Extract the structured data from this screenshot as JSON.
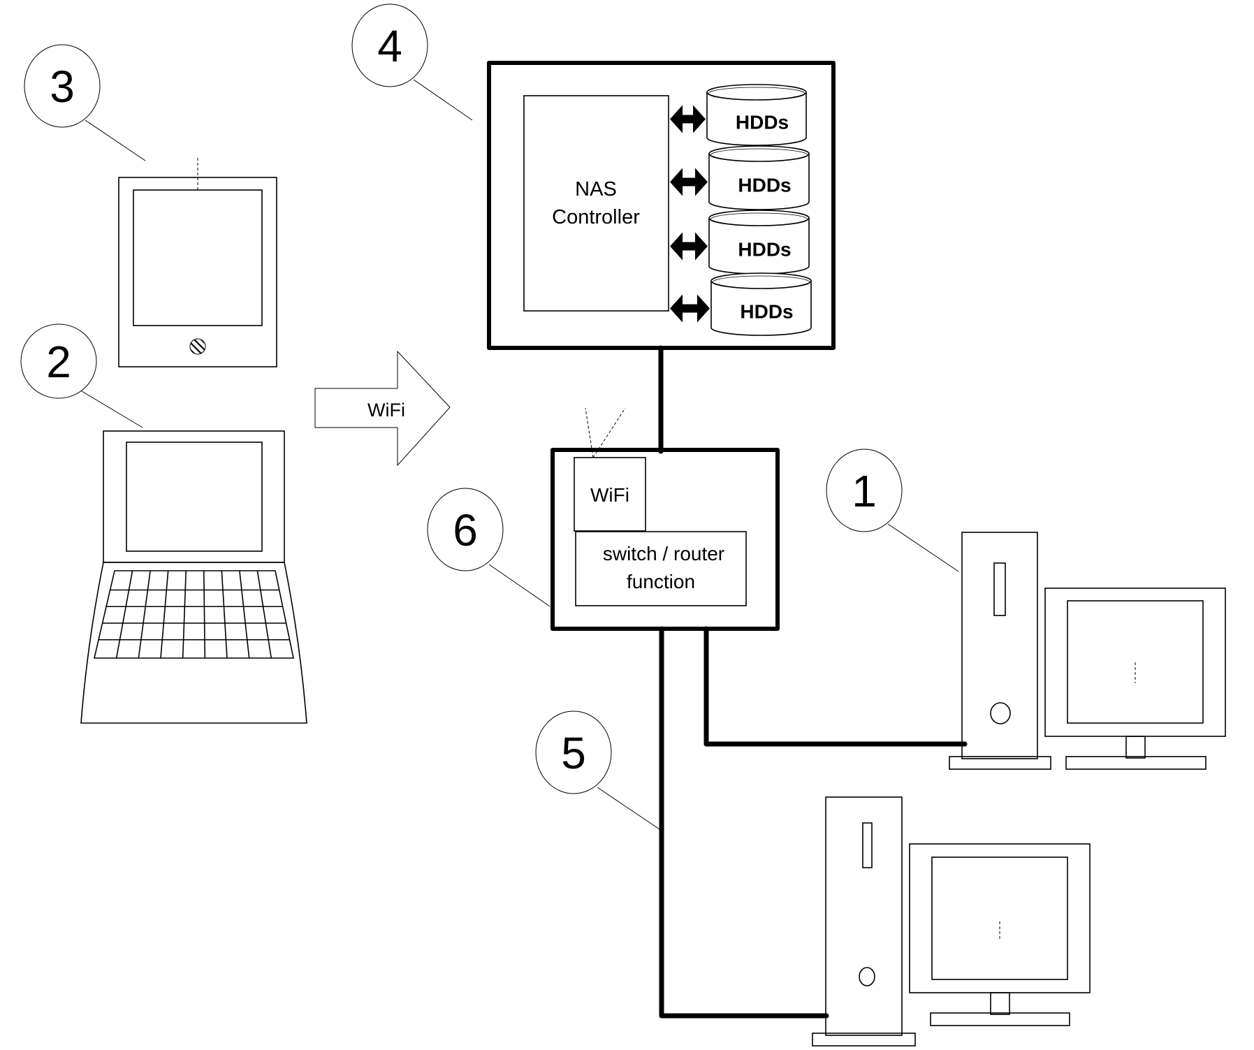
{
  "diagram": {
    "type": "network-attached-storage topology",
    "callouts": [
      {
        "number": "1",
        "refers_to": "desktop-pc-1"
      },
      {
        "number": "2",
        "refers_to": "laptop"
      },
      {
        "number": "3",
        "refers_to": "tablet"
      },
      {
        "number": "4",
        "refers_to": "nas-device"
      },
      {
        "number": "5",
        "refers_to": "wired-cable"
      },
      {
        "number": "6",
        "refers_to": "router"
      }
    ],
    "nas": {
      "controller_label_line1": "NAS",
      "controller_label_line2": "Controller",
      "hdd_labels": [
        "HDDs",
        "HDDs",
        "HDDs",
        "HDDs"
      ]
    },
    "wireless_arrow": {
      "label": "WiFi"
    },
    "router": {
      "wifi_label": "WiFi",
      "switch_label_line1": "switch / router",
      "switch_label_line2": "function"
    },
    "connections": [
      {
        "from": "nas-device",
        "to": "router",
        "kind": "wired"
      },
      {
        "from": "router",
        "to": "desktop-pc-1",
        "kind": "wired"
      },
      {
        "from": "router",
        "to": "desktop-pc-2",
        "kind": "wired"
      },
      {
        "from": "laptop",
        "to": "router",
        "kind": "wifi"
      },
      {
        "from": "tablet",
        "to": "router",
        "kind": "wifi"
      }
    ]
  }
}
